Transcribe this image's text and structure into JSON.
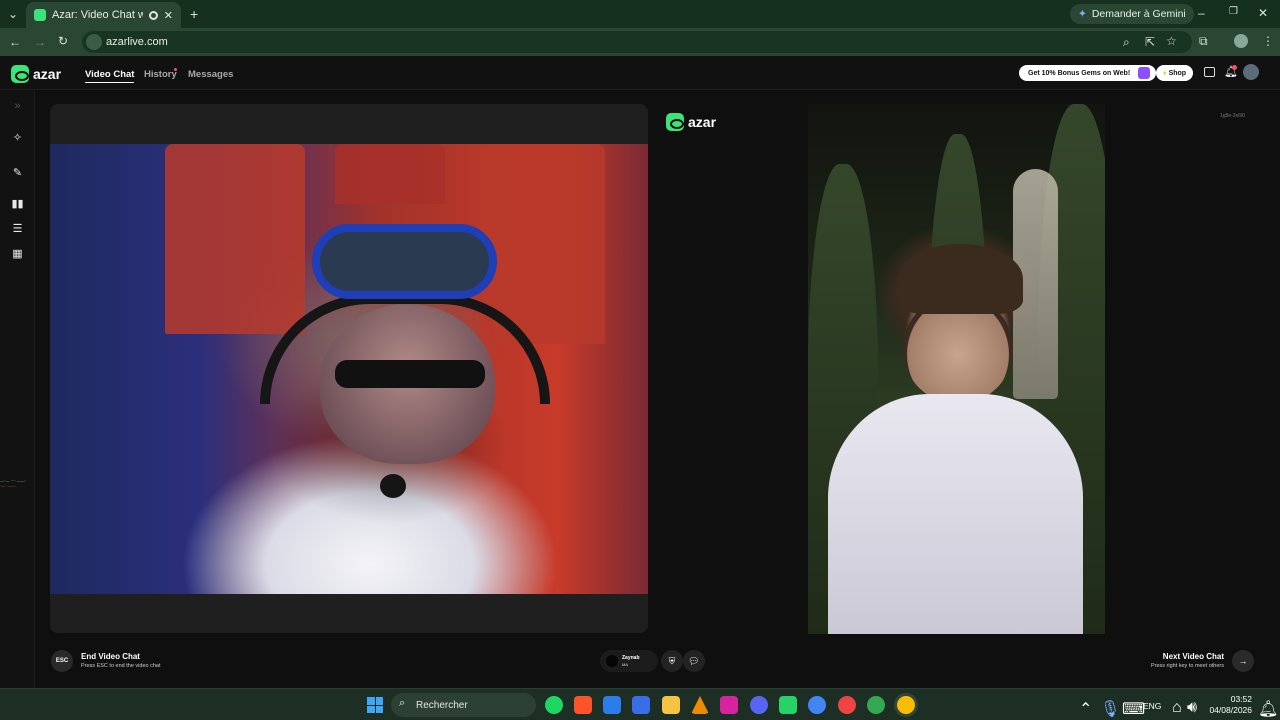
{
  "browser": {
    "tab_title": "Azar: Video Chat with New",
    "gemini_label": "Demander à Gemini",
    "url": "azarlive.com"
  },
  "header": {
    "brand": "azar",
    "nav": [
      {
        "label": "Video Chat",
        "active": true
      },
      {
        "label": "History",
        "badge": true
      },
      {
        "label": "Messages"
      }
    ],
    "promo_label": "Get 10% Bonus Gems on Web!",
    "shop_label": "Shop",
    "accent_color": "#3ee27a"
  },
  "rail": {
    "icons": [
      "collapse-icon",
      "magic-wand-icon",
      "edit-icon",
      "layout-columns-icon",
      "layout-rows-icon",
      "layout-grid-icon"
    ]
  },
  "right_panel": {
    "brand": "azar",
    "user_id": "1g8e-3s6t0"
  },
  "edge_overlay": {
    "line1": "—·— ···· ——·",
    "line2": "·—· ——"
  },
  "controls": {
    "end": {
      "key": "ESC",
      "title": "End Video Chat",
      "hint": "Press ESC to end the video chat"
    },
    "partner": {
      "name": "Zaynab",
      "country": "MA"
    },
    "next": {
      "title": "Next Video Chat",
      "hint": "Press right key to meet others"
    }
  },
  "taskbar": {
    "search_placeholder": "Rechercher",
    "language": "ENG",
    "time": "03:52",
    "date": "04/08/2026"
  }
}
